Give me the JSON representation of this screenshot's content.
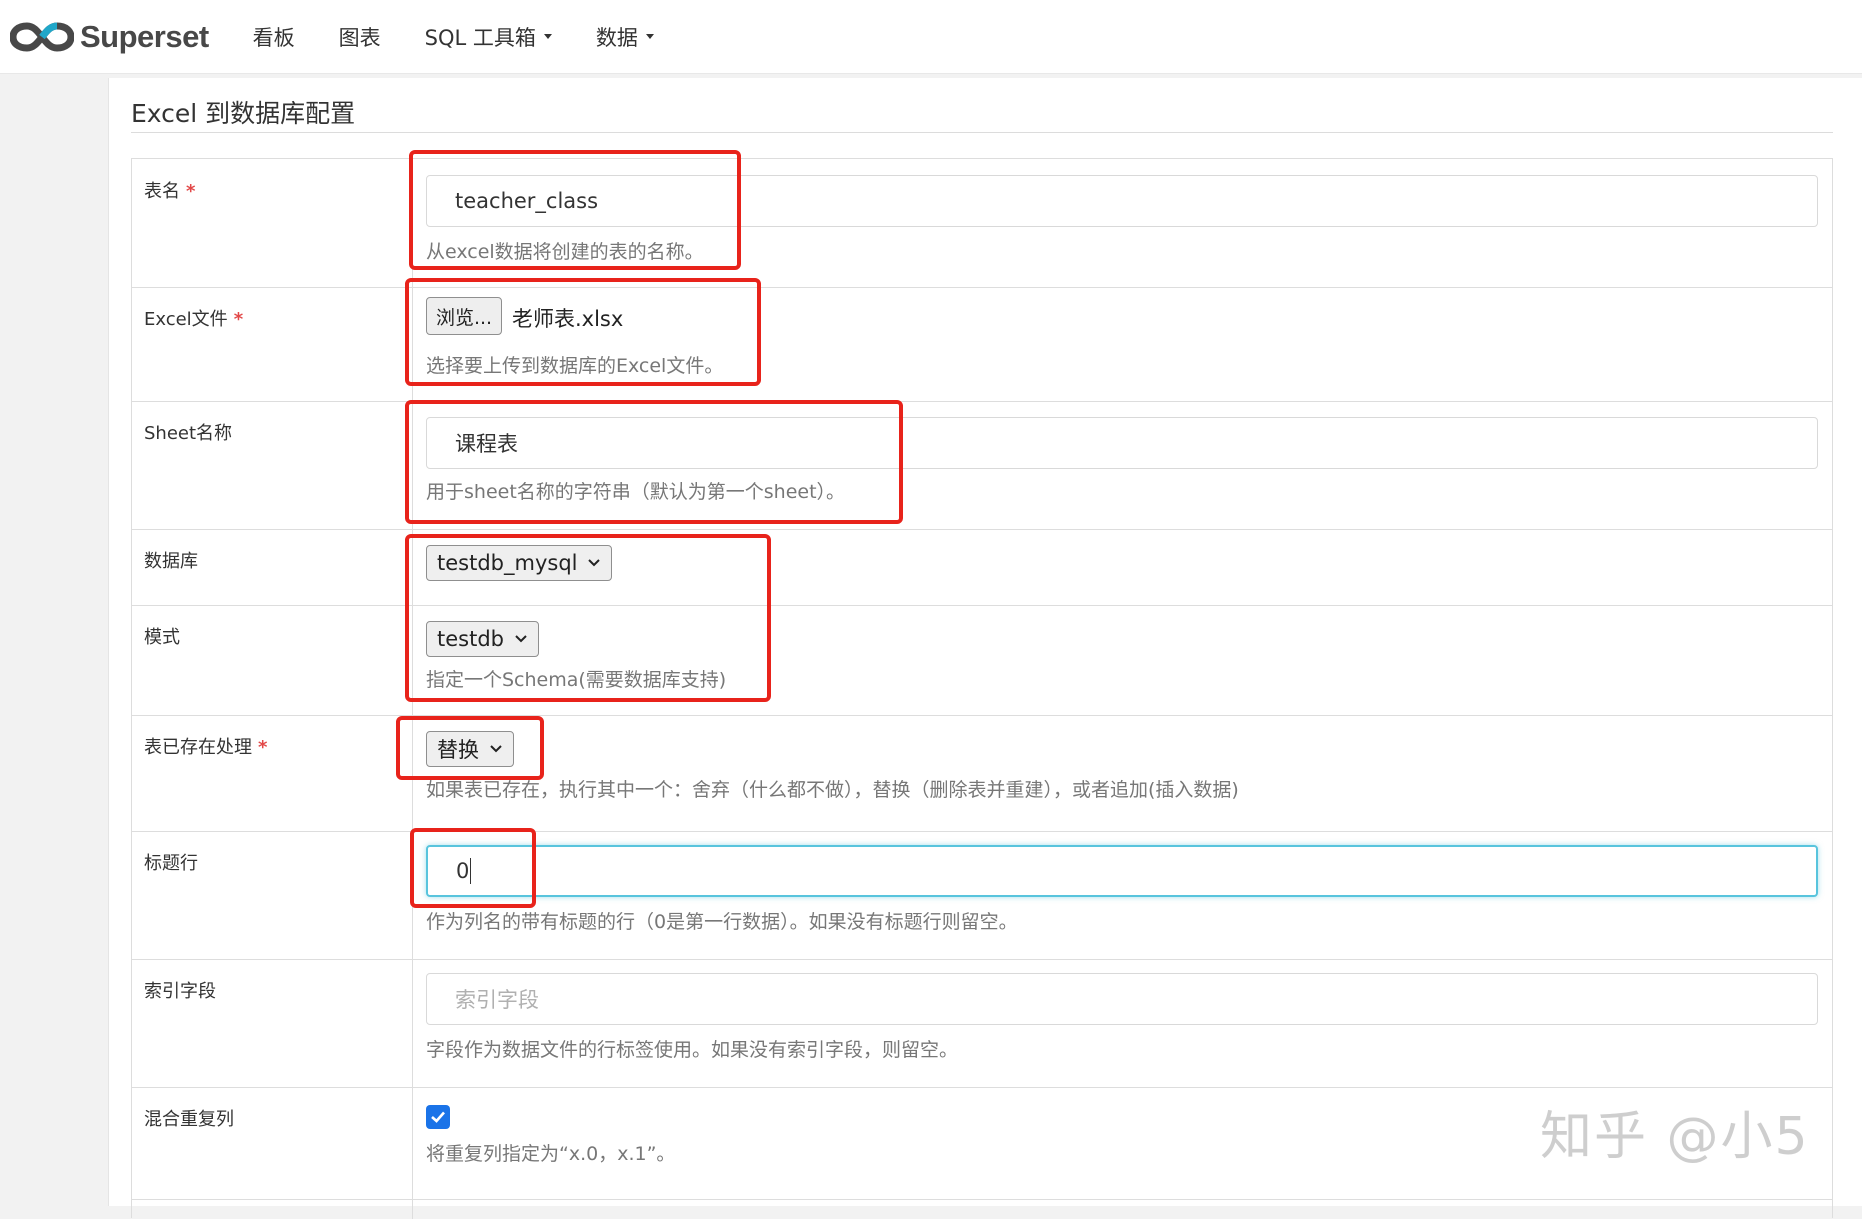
{
  "navbar": {
    "brand": "Superset",
    "items": [
      {
        "label": "看板",
        "dropdown": false
      },
      {
        "label": "图表",
        "dropdown": false
      },
      {
        "label": "SQL 工具箱",
        "dropdown": true
      },
      {
        "label": "数据",
        "dropdown": true
      }
    ]
  },
  "form": {
    "title": "Excel 到数据库配置",
    "table_name": {
      "label": "表名",
      "value": "teacher_class",
      "help": "从excel数据将创建的表的名称。"
    },
    "excel_file": {
      "label": "Excel文件",
      "browse_label": "浏览...",
      "file_name": "老师表.xlsx",
      "help": "选择要上传到数据库的Excel文件。"
    },
    "sheet_name": {
      "label": "Sheet名称",
      "value": "课程表",
      "help": "用于sheet名称的字符串（默认为第一个sheet）。"
    },
    "database": {
      "label": "数据库",
      "selected": "testdb_mysql"
    },
    "schema": {
      "label": "模式",
      "selected": "testdb",
      "help": "指定一个Schema(需要数据库支持)"
    },
    "if_exists": {
      "label": "表已存在处理",
      "selected": "替换",
      "help": "如果表已存在，执行其中一个：舍弃（什么都不做），替换（删除表并重建），或者追加(插入数据)"
    },
    "header_row": {
      "label": "标题行",
      "value": "0",
      "help": "作为列名的带有标题的行（0是第一行数据）。如果没有标题行则留空。"
    },
    "index_column": {
      "label": "索引字段",
      "placeholder": "索引字段",
      "help": "字段作为数据文件的行标签使用。如果没有索引字段，则留空。"
    },
    "mangle_dupe_cols": {
      "label": "混合重复列",
      "checked": true,
      "help": "将重复列指定为“x.0，x.1”。"
    },
    "required_mark": "*"
  },
  "watermark": "知乎 @小5",
  "colors": {
    "annotation_red": "#e8231b",
    "focus_blue": "#58c4dd",
    "checkbox_blue": "#1a73e8",
    "required_red": "#e24848"
  }
}
